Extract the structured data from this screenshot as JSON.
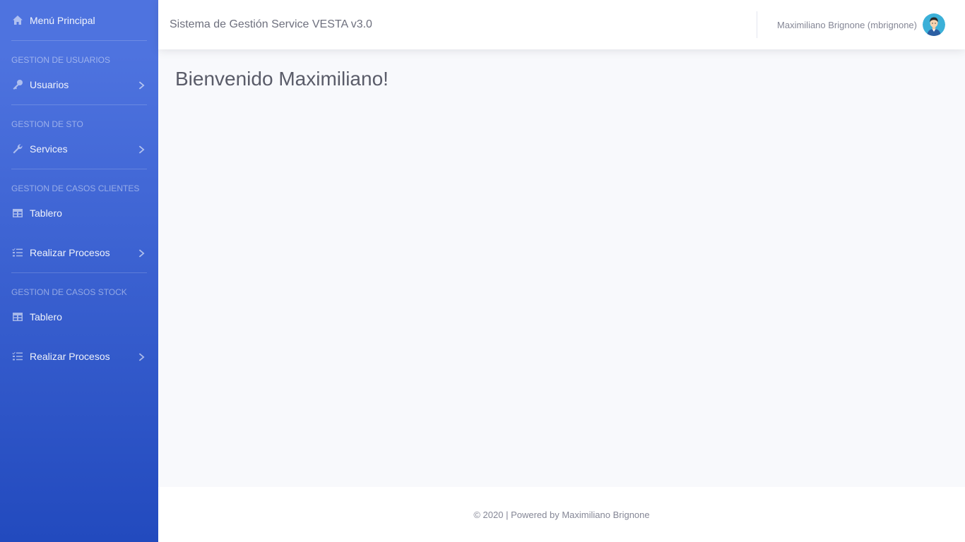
{
  "sidebar": {
    "top_item": {
      "label": "Menú Principal",
      "icon": "home-icon"
    },
    "sections": [
      {
        "heading": "GESTION DE USUARIOS",
        "items": [
          {
            "label": "Usuarios",
            "icon": "key-icon",
            "has_submenu": true
          }
        ]
      },
      {
        "heading": "GESTION DE STO",
        "items": [
          {
            "label": "Services",
            "icon": "wrench-icon",
            "has_submenu": true
          }
        ]
      },
      {
        "heading": "GESTION DE CASOS CLIENTES",
        "items": [
          {
            "label": "Tablero",
            "icon": "table-icon",
            "has_submenu": false
          },
          {
            "label": "Realizar Procesos",
            "icon": "tasks-icon",
            "has_submenu": true
          }
        ]
      },
      {
        "heading": "GESTION DE CASOS STOCK",
        "items": [
          {
            "label": "Tablero",
            "icon": "table-icon",
            "has_submenu": false
          },
          {
            "label": "Realizar Procesos",
            "icon": "tasks-icon",
            "has_submenu": true
          }
        ]
      }
    ]
  },
  "topbar": {
    "title": "Sistema de Gestión Service VESTA v3.0",
    "user_name": "Maximiliano Brignone (mbrignone)"
  },
  "main": {
    "heading": "Bienvenido Maximiliano!"
  },
  "footer": {
    "text": "© 2020 | Powered by Maximiliano Brignone"
  },
  "colors": {
    "sidebar_top": "#4e73df",
    "sidebar_bottom": "#224abe",
    "background": "#f8f9fc"
  }
}
